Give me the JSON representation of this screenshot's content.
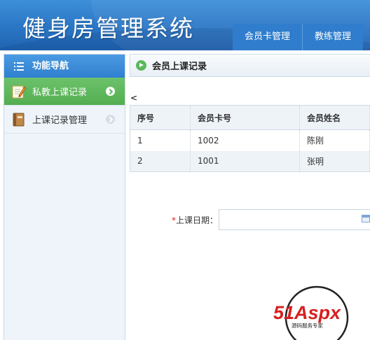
{
  "header": {
    "app_title": "健身房管理系统",
    "nav": [
      "会员卡管理",
      "教练管理"
    ]
  },
  "sidebar": {
    "title": "功能导航",
    "items": [
      {
        "label": "私教上课记录",
        "active": true,
        "icon": "edit-note-icon"
      },
      {
        "label": "上课记录管理",
        "active": false,
        "icon": "book-icon"
      }
    ]
  },
  "main": {
    "section_title": "会员上课记录",
    "stray_text": "<",
    "table": {
      "columns": [
        "序号",
        "会员卡号",
        "会员姓名"
      ],
      "rows": [
        [
          "1",
          "1002",
          "陈刚"
        ],
        [
          "2",
          "1001",
          "张明"
        ]
      ]
    },
    "form": {
      "required_mark": "*",
      "date_label": "上课日期：",
      "date_value": ""
    }
  },
  "watermark": {
    "brand": "51Aspx",
    "tagline": "源码服务专家"
  },
  "colors": {
    "header_blue": "#2a76c5",
    "active_green": "#5cb85c",
    "required_red": "#e02020"
  }
}
